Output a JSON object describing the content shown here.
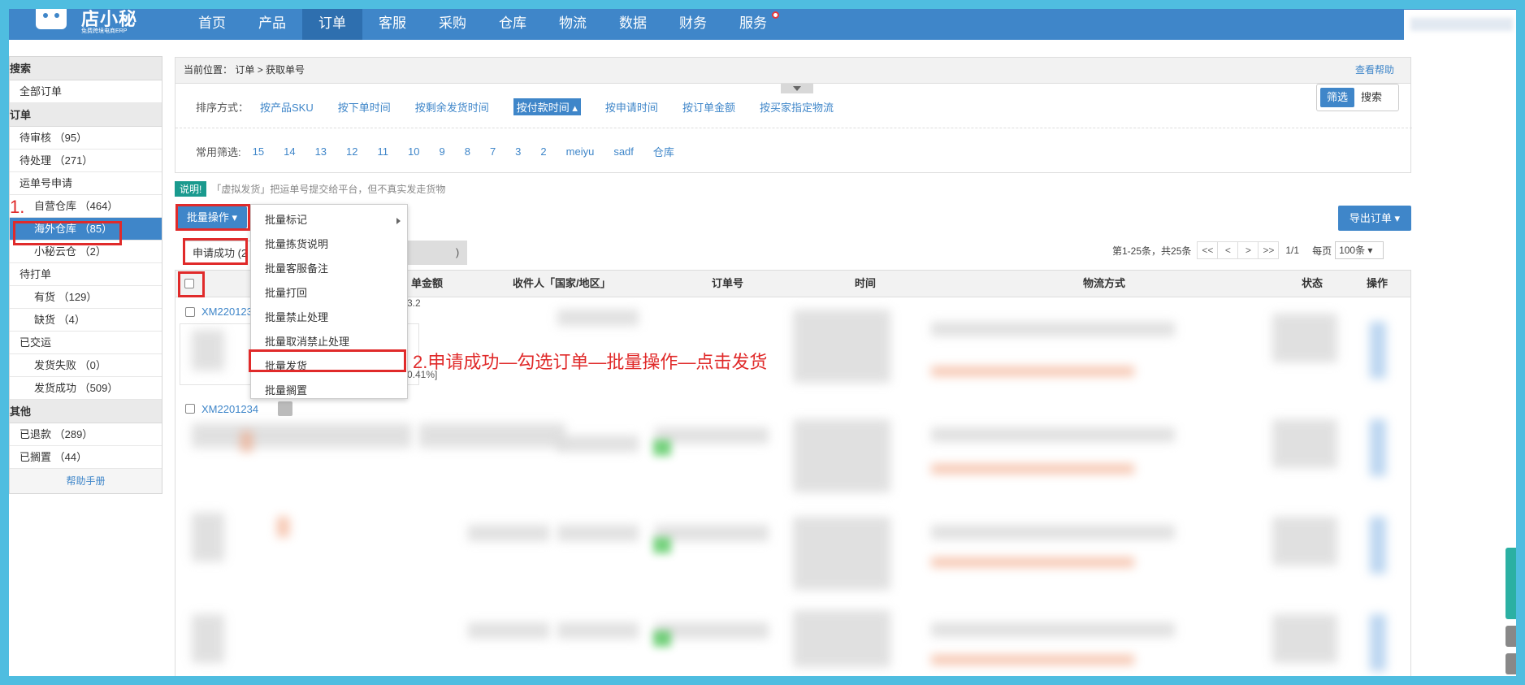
{
  "logo": {
    "name": "店小秘",
    "tagline": "免费跨境电商ERP"
  },
  "nav": [
    "首页",
    "产品",
    "订单",
    "客服",
    "采购",
    "仓库",
    "物流",
    "数据",
    "财务",
    "服务"
  ],
  "nav_active": "订单",
  "sidebar": {
    "search_group": "搜索",
    "all_orders": "全部订单",
    "order_group": "订单",
    "pending_review": "待审核 （95）",
    "pending_process": "待处理 （271）",
    "waybill_apply": "运单号申请",
    "self_warehouse": "自营仓库 （464）",
    "overseas_warehouse": "海外仓库 （85）",
    "xiaomi_cloud": "小秘云仓 （2）",
    "to_print": "待打单",
    "in_stock": "有货 （129）",
    "out_of_stock": "缺货 （4）",
    "shipped_group": "已交运",
    "ship_failed": "发货失败 （0）",
    "ship_success": "发货成功 （509）",
    "other_group": "其他",
    "refunded": "已退款 （289）",
    "on_hold": "已搁置 （44）",
    "help": "帮助手册"
  },
  "breadcrumb": {
    "label": "当前位置：",
    "path": "订单 > 获取单号",
    "help": "查看帮助"
  },
  "sort": {
    "label": "排序方式：",
    "options": [
      "按产品SKU",
      "按下单时间",
      "按剩余发货时间",
      "按付款时间",
      "按申请时间",
      "按订单金额",
      "按买家指定物流"
    ],
    "active": "按付款时间 ▴"
  },
  "filter": {
    "label": "常用筛选:",
    "options": [
      "15",
      "14",
      "13",
      "12",
      "11",
      "10",
      "9",
      "8",
      "7",
      "3",
      "2",
      "meiyu",
      "sadf",
      "仓库"
    ]
  },
  "toggle": {
    "filter": "筛选",
    "search": "搜索"
  },
  "note": {
    "tag": "说明!",
    "text": "「虚拟发货」把运单号提交给平台，但不真实发走货物"
  },
  "batch_button": "批量操作 ▾",
  "export_button": "导出订单 ▾",
  "tabs": {
    "success": "申请成功 (2",
    "other": ")"
  },
  "pager": {
    "summary": "第1-25条，共25条",
    "first": "<<",
    "prev": "<",
    "next": ">",
    "last": ">>",
    "page": "1/1",
    "per_page_label": "每页",
    "per_page": "100条 ▾"
  },
  "table_headers": {
    "amount": "单金额",
    "recipient": "收件人「国家/地区」",
    "order_no": "订单号",
    "time": "时间",
    "logistics": "物流方式",
    "status": "状态",
    "action": "操作"
  },
  "orders": [
    "XM220123",
    "XM2201234"
  ],
  "order_pct": {
    "a": "3.2",
    "b": "0.41%]"
  },
  "batch_menu": [
    "批量标记",
    "批量拣货说明",
    "批量客服备注",
    "批量打回",
    "批量禁止处理",
    "批量取消禁止处理",
    "批量发货",
    "批量搁置"
  ],
  "annotations": {
    "step1": "1.",
    "step2": "2.申请成功—勾选订单—批量操作—点击发货"
  },
  "colors": {
    "nav_bg": "#3f86c9",
    "accent": "#3f86c9",
    "annotation": "#e02a2a",
    "frame": "#4fbde0"
  }
}
